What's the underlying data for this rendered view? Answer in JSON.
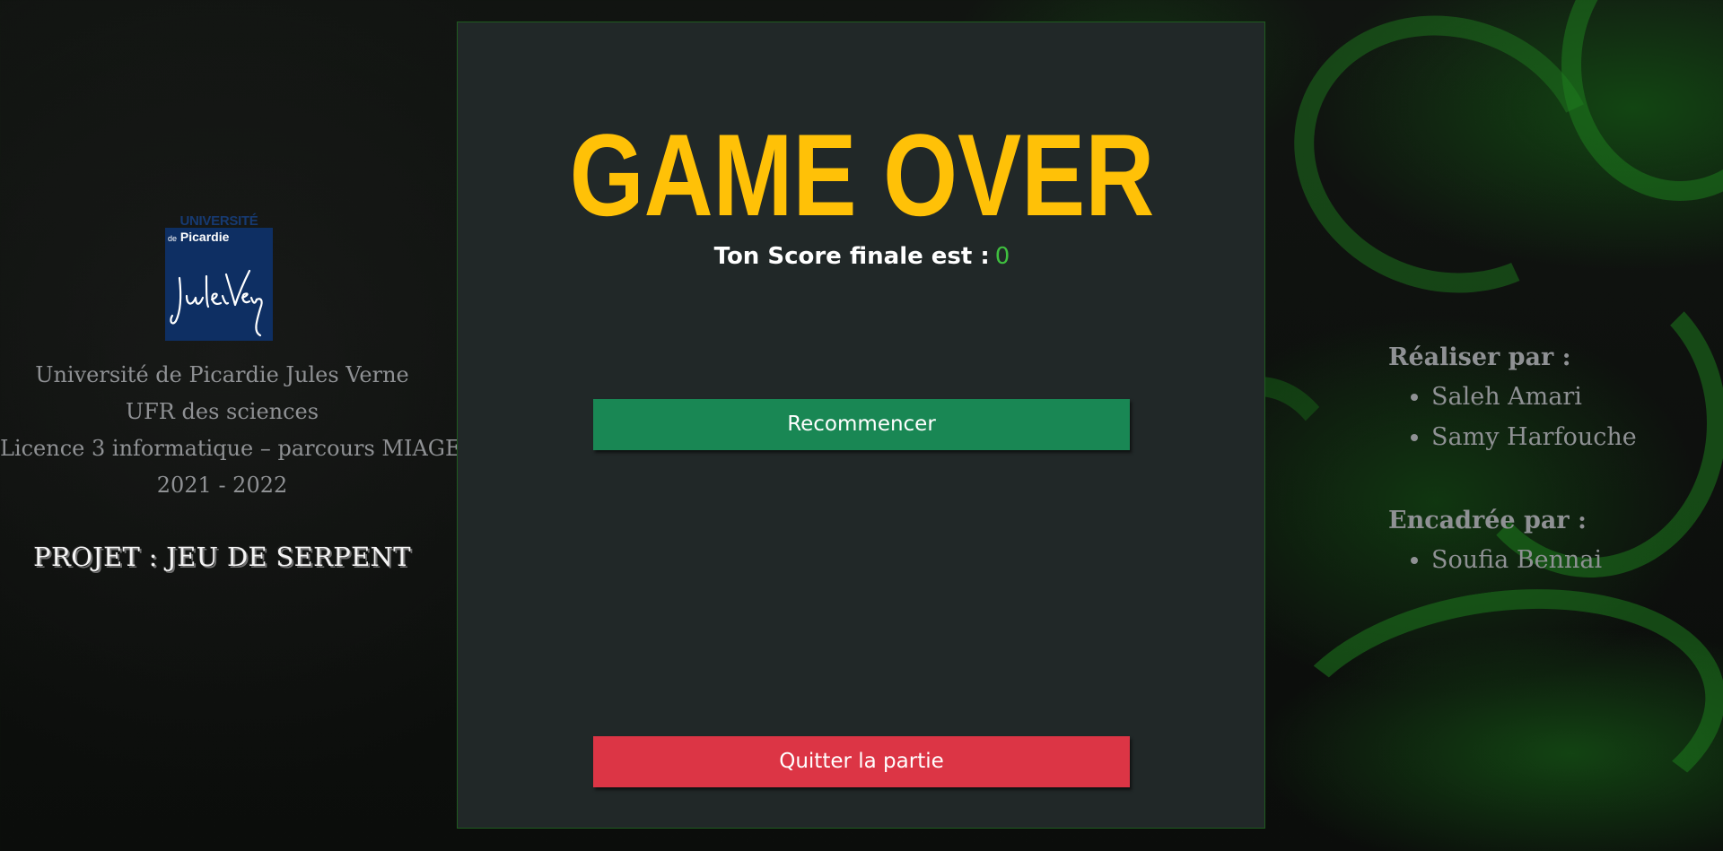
{
  "colors": {
    "title": "#ffc107",
    "score_value": "#3fbf3f",
    "restart_button": "#198754",
    "quit_button": "#dc3545",
    "panel": "#212828"
  },
  "left": {
    "logo": {
      "top_text": "UNIVERSITÉ",
      "sub_prefix": "de",
      "sub_text": "Picardie"
    },
    "lines": [
      "Université de Picardie Jules Verne",
      "UFR des sciences",
      "Licence 3 informatique – parcours MIAGE",
      "2021 - 2022"
    ],
    "project_title": "PROJET : JEU DE SERPENT"
  },
  "game": {
    "title": "GAME OVER",
    "score_label": "Ton Score finale est :",
    "score_value": "0",
    "restart_label": "Recommencer",
    "quit_label": "Quitter la partie"
  },
  "right": {
    "made_by_heading": "Réaliser par :",
    "made_by": [
      "Saleh Amari",
      "Samy Harfouche"
    ],
    "supervised_heading": "Encadrée par :",
    "supervised_by": [
      "Soufia Bennai"
    ]
  }
}
